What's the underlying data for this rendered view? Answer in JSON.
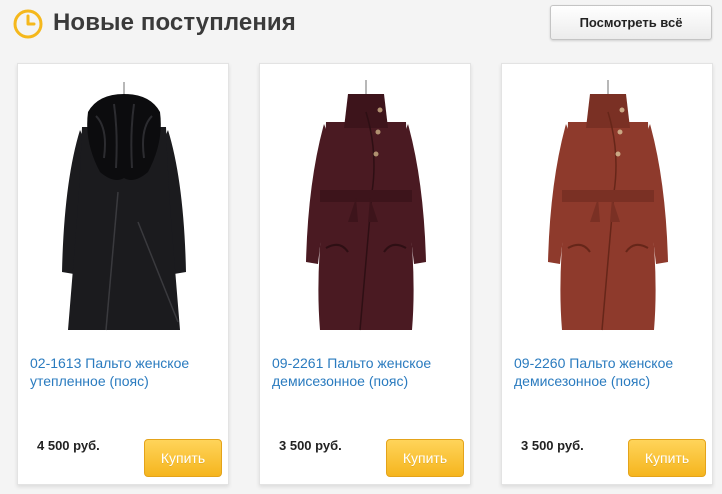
{
  "header": {
    "title": "Новые поступления",
    "view_all_label": "Посмотреть всё",
    "icon": "clock-icon",
    "accent_color": "#f5b81c"
  },
  "products": [
    {
      "name": "02-1613 Пальто женское утепленное (пояс)",
      "price": "4 500 руб.",
      "buy_label": "Купить",
      "image_icon": "coat-image",
      "coat_color": "#1b1b1e",
      "has_fur_collar": true
    },
    {
      "name": "09-2261 Пальто женское демисезонное (пояс)",
      "price": "3 500 руб.",
      "buy_label": "Купить",
      "image_icon": "coat-image",
      "coat_color": "#4a1a22",
      "has_fur_collar": false
    },
    {
      "name": "09-2260 Пальто женское демисезонное (пояс)",
      "price": "3 500 руб.",
      "buy_label": "Купить",
      "image_icon": "coat-image",
      "coat_color": "#8e3a2c",
      "has_fur_collar": false
    }
  ],
  "colors": {
    "link": "#2a7bbf",
    "buy_button": "#f5b51e"
  }
}
